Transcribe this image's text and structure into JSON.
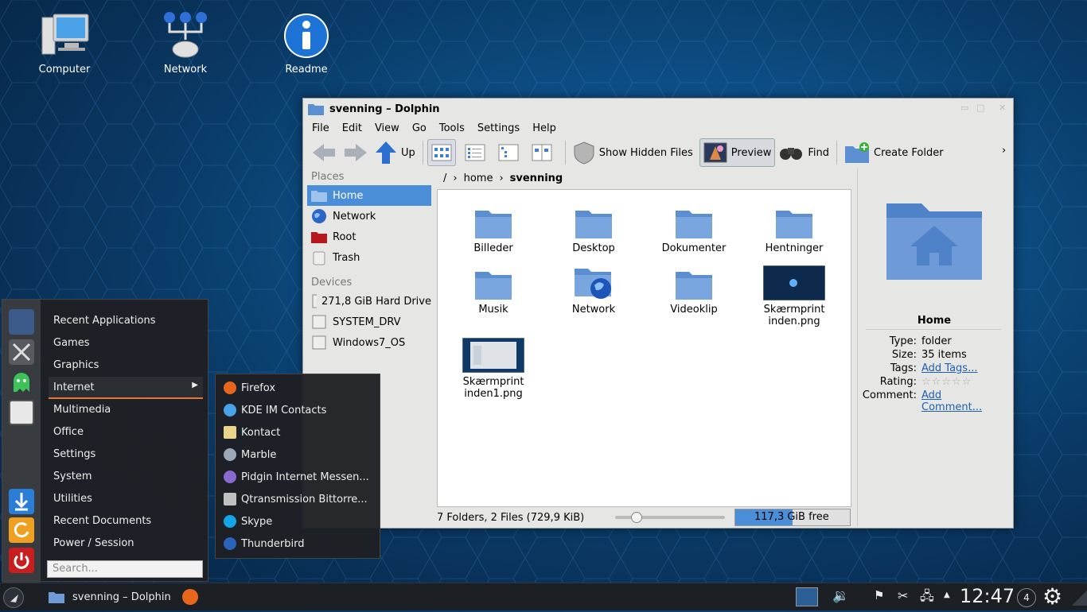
{
  "desktop": {
    "icons": [
      {
        "label": "Computer",
        "icon": "computer-icon"
      },
      {
        "label": "Network",
        "icon": "network-icon"
      },
      {
        "label": "Readme",
        "icon": "info-icon"
      }
    ]
  },
  "window": {
    "title": "svenning – Dolphin",
    "menu": [
      "File",
      "Edit",
      "View",
      "Go",
      "Tools",
      "Settings",
      "Help"
    ],
    "toolbar": {
      "up": "Up",
      "show_hidden": "Show Hidden Files",
      "preview": "Preview",
      "find": "Find",
      "create_folder": "Create Folder",
      "overflow": "›"
    },
    "places": {
      "header": "Places",
      "items": [
        "Home",
        "Network",
        "Root",
        "Trash"
      ],
      "devices_header": "Devices",
      "devices": [
        "271,8 GiB Hard Drive",
        "SYSTEM_DRV",
        "Windows7_OS"
      ]
    },
    "breadcrumb": [
      "/",
      "home",
      "svenning"
    ],
    "files": [
      {
        "name": "Billeder",
        "kind": "folder"
      },
      {
        "name": "Desktop",
        "kind": "folder"
      },
      {
        "name": "Dokumenter",
        "kind": "folder"
      },
      {
        "name": "Hentninger",
        "kind": "folder"
      },
      {
        "name": "Musik",
        "kind": "folder"
      },
      {
        "name": "Network",
        "kind": "network"
      },
      {
        "name": "Videoklip",
        "kind": "folder"
      },
      {
        "name": "Skærmprint inden.png",
        "kind": "image"
      },
      {
        "name": "Skærmprint inden1.png",
        "kind": "image"
      }
    ],
    "status": {
      "summary": "7 Folders, 2 Files (729,9 KiB)",
      "free": "117,3 GiB free",
      "free_fill": 0.5
    },
    "info": {
      "title": "Home",
      "type_k": "Type:",
      "type_v": "folder",
      "size_k": "Size:",
      "size_v": "35 items",
      "tags_k": "Tags:",
      "tags_v": "Add Tags...",
      "rating_k": "Rating:",
      "rating_v": 0,
      "comment_k": "Comment:",
      "comment_v": "Add Comment..."
    }
  },
  "startmenu": {
    "items": [
      "Recent Applications",
      "Games",
      "Graphics",
      "Internet",
      "Multimedia",
      "Office",
      "Settings",
      "System",
      "Utilities",
      "Recent Documents",
      "Power / Session"
    ],
    "selected": "Internet",
    "search_placeholder": "Search...",
    "submenu": [
      "Firefox",
      "KDE IM Contacts",
      "Kontact",
      "Marble",
      "Pidgin Internet Messen...",
      "Qtransmission Bittorre...",
      "Skype",
      "Thunderbird"
    ]
  },
  "taskbar": {
    "task": "svenning – Dolphin",
    "clock": "12:47",
    "notifications": "4"
  },
  "colors": {
    "accent": "#4a8ed8",
    "desktop": "#0d4f86"
  }
}
